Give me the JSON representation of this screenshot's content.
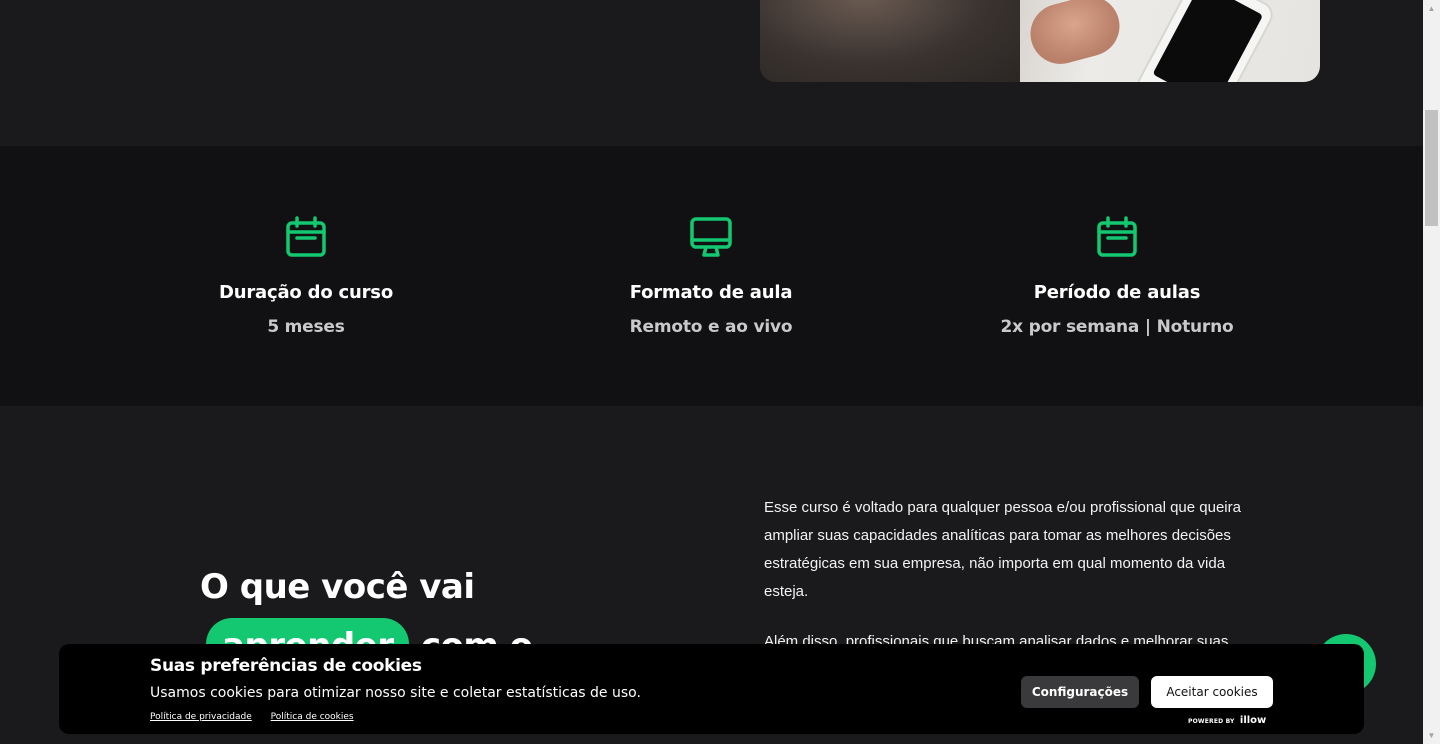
{
  "features": [
    {
      "icon": "calendar-icon",
      "title": "Duração do curso",
      "value": "5 meses"
    },
    {
      "icon": "monitor-icon",
      "title": "Formato de aula",
      "value": "Remoto e ao vivo"
    },
    {
      "icon": "calendar-icon",
      "title": "Período de aulas",
      "value": "2x por semana | Noturno"
    }
  ],
  "learn": {
    "heading_line1": "O que você vai",
    "heading_highlight": "aprender",
    "heading_rest": "com o",
    "paragraph1": "Esse curso é voltado para qualquer pessoa e/ou profissional que queira ampliar suas capacidades analíticas para tomar as melhores decisões estratégicas em sua empresa, não importa em qual momento da vida esteja.",
    "paragraph2": "Além disso, profissionais que buscam analisar dados e melhorar suas"
  },
  "cookie_banner": {
    "title": "Suas preferências de cookies",
    "text": "Usamos cookies para otimizar nosso site e coletar estatísticas de uso.",
    "privacy_link": "Política de privacidade",
    "cookies_link": "Política de cookies",
    "config_button": "Configurações",
    "accept_button": "Aceitar cookies",
    "powered_by": "POWERED BY",
    "brand": "illow"
  },
  "colors": {
    "accent": "#13c870",
    "background": "#1a1a1c",
    "band": "#111113"
  }
}
